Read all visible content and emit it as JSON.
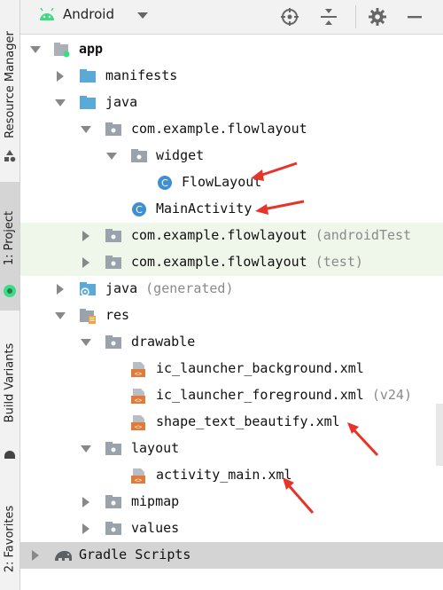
{
  "sidebar": {
    "tabs": [
      {
        "label": "Resource Manager"
      },
      {
        "label": "1: Project"
      },
      {
        "label": "Build Variants"
      },
      {
        "label": "2: Favorites"
      }
    ]
  },
  "toolbar": {
    "view_label": "Android",
    "icons": [
      "locate-icon",
      "collapse-all-icon",
      "settings-gear-icon",
      "hide-minus-icon"
    ]
  },
  "tree": [
    {
      "label": "app",
      "suffix": "",
      "icon": "app-module-icon",
      "expanded": true,
      "bold": true
    },
    {
      "label": "manifests",
      "suffix": "",
      "icon": "folder-icon",
      "expanded": false
    },
    {
      "label": "java",
      "suffix": "",
      "icon": "folder-icon",
      "expanded": true
    },
    {
      "label": "com.example.flowlayout",
      "suffix": "",
      "icon": "package-icon",
      "expanded": true
    },
    {
      "label": "widget",
      "suffix": "",
      "icon": "package-icon",
      "expanded": true
    },
    {
      "label": "FlowLayout",
      "suffix": "",
      "icon": "class-icon"
    },
    {
      "label": "MainActivity",
      "suffix": "",
      "icon": "class-icon"
    },
    {
      "label": "com.example.flowlayout",
      "suffix": "(androidTest",
      "icon": "package-icon",
      "expanded": false
    },
    {
      "label": "com.example.flowlayout",
      "suffix": "(test)",
      "icon": "package-icon",
      "expanded": false
    },
    {
      "label": "java",
      "suffix": "(generated)",
      "icon": "generated-folder-icon",
      "expanded": false
    },
    {
      "label": "res",
      "suffix": "",
      "icon": "res-folder-icon",
      "expanded": true
    },
    {
      "label": "drawable",
      "suffix": "",
      "icon": "package-icon",
      "expanded": true
    },
    {
      "label": "ic_launcher_background.xml",
      "suffix": "",
      "icon": "xml-file-icon"
    },
    {
      "label": "ic_launcher_foreground.xml",
      "suffix": "(v24)",
      "icon": "xml-file-icon"
    },
    {
      "label": "shape_text_beautify.xml",
      "suffix": "",
      "icon": "xml-file-icon"
    },
    {
      "label": "layout",
      "suffix": "",
      "icon": "package-icon",
      "expanded": true
    },
    {
      "label": "activity_main.xml",
      "suffix": "",
      "icon": "xml-file-icon"
    },
    {
      "label": "mipmap",
      "suffix": "",
      "icon": "package-icon",
      "expanded": false
    },
    {
      "label": "values",
      "suffix": "",
      "icon": "package-icon",
      "expanded": false
    },
    {
      "label": "Gradle Scripts",
      "suffix": "",
      "icon": "gradle-icon",
      "expanded": false
    }
  ],
  "colors": {
    "folder_blue": "#5ba9d6",
    "package_grey": "#9aa3ab",
    "class_blue": "#3f8fd1",
    "xml_orange": "#e07b3a",
    "annotation_red": "#e8332a",
    "android_green": "#3ddc84"
  }
}
